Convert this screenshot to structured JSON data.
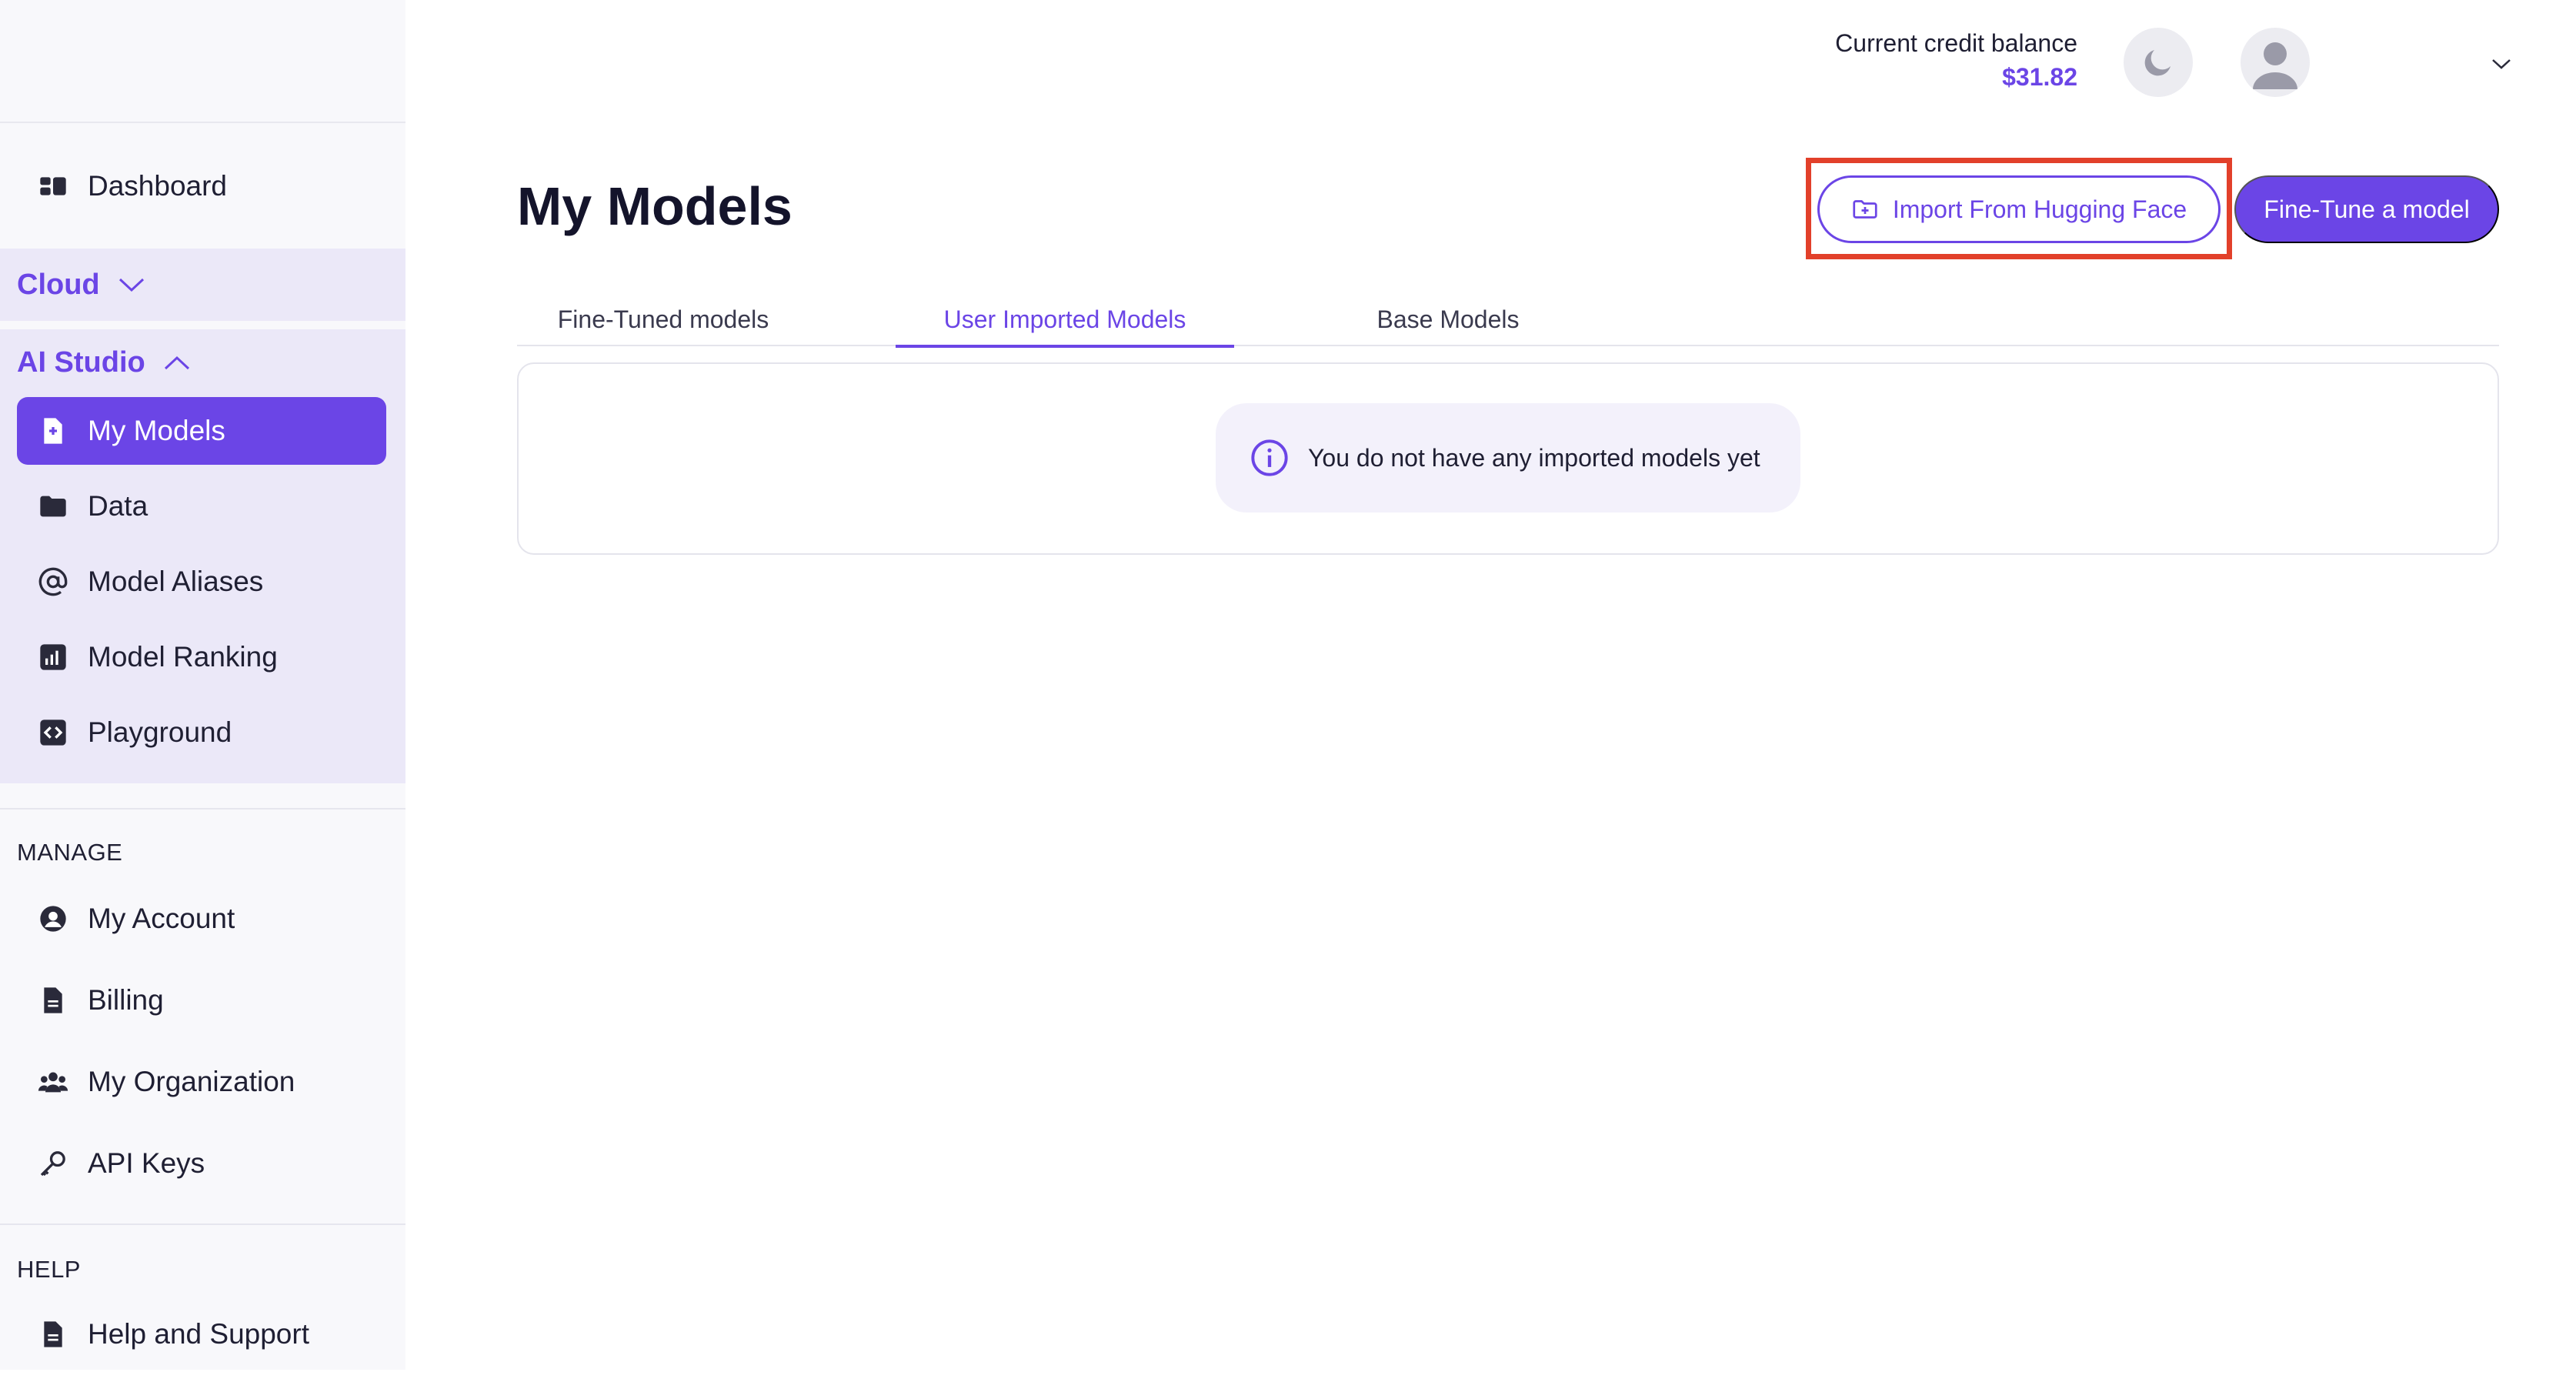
{
  "header": {
    "credit_label": "Current credit balance",
    "credit_value": "$31.82",
    "theme_icon": "moon-icon",
    "avatar_icon": "user-icon",
    "menu_icon": "chevron-down-icon"
  },
  "sidebar": {
    "dashboard": "Dashboard",
    "cloud": "Cloud",
    "ai_studio": "AI Studio",
    "ai_items": [
      {
        "label": "My Models",
        "icon": "model-file-icon",
        "active": true
      },
      {
        "label": "Data",
        "icon": "folder-icon"
      },
      {
        "label": "Model Aliases",
        "icon": "at-sign-icon"
      },
      {
        "label": "Model Ranking",
        "icon": "bar-chart-icon"
      },
      {
        "label": "Playground",
        "icon": "code-icon"
      }
    ],
    "manage_label": "MANAGE",
    "manage_items": [
      {
        "label": "My Account",
        "icon": "account-icon"
      },
      {
        "label": "Billing",
        "icon": "document-icon"
      },
      {
        "label": "My Organization",
        "icon": "users-icon"
      },
      {
        "label": "API Keys",
        "icon": "key-icon"
      }
    ],
    "help_label": "HELP",
    "help_items": [
      {
        "label": "Help and Support",
        "icon": "document-icon"
      }
    ]
  },
  "main": {
    "title": "My Models",
    "import_button": "Import From Hugging Face",
    "finetune_button": "Fine-Tune a model",
    "tabs": [
      {
        "label": "Fine-Tuned models",
        "active": false
      },
      {
        "label": "User Imported Models",
        "active": true
      },
      {
        "label": "Base Models",
        "active": false
      }
    ],
    "empty_message": "You do not have any imported models yet"
  },
  "colors": {
    "accent": "#6b45e6",
    "highlight": "#e2402a",
    "sidebar_section_bg": "#ebe8f8"
  }
}
